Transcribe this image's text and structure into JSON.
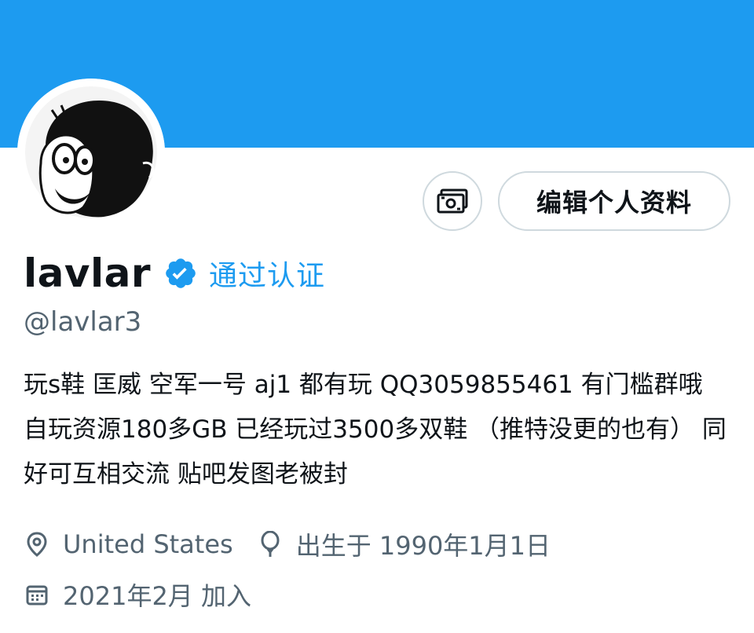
{
  "colors": {
    "banner": "#1d9bf0",
    "accent": "#1d9bf0",
    "text_primary": "#0f1419",
    "text_secondary": "#536471",
    "button_border": "#cfd9de"
  },
  "header": {
    "banner_icon": "banner-image",
    "avatar_icon": "avatar-cartoon-boy"
  },
  "actions": {
    "tip_icon": "money-icon",
    "edit_profile_label": "编辑个人资料"
  },
  "profile": {
    "display_name": "lavlar",
    "verified_icon": "verified-badge-icon",
    "verified_label": "通过认证",
    "handle": "@lavlar3",
    "bio": "玩s鞋 匡威 空军一号 aj1 都有玩 QQ3059855461 有门槛群哦  自玩资源180多GB 已经玩过3500多双鞋 （推特没更的也有） 同好可互相交流  贴吧发图老被封"
  },
  "meta": {
    "location_icon": "location-pin-icon",
    "location": "United States",
    "birthday_icon": "balloon-icon",
    "birthday": "出生于 1990年1月1日",
    "joined_icon": "calendar-icon",
    "joined": "2021年2月 加入"
  }
}
